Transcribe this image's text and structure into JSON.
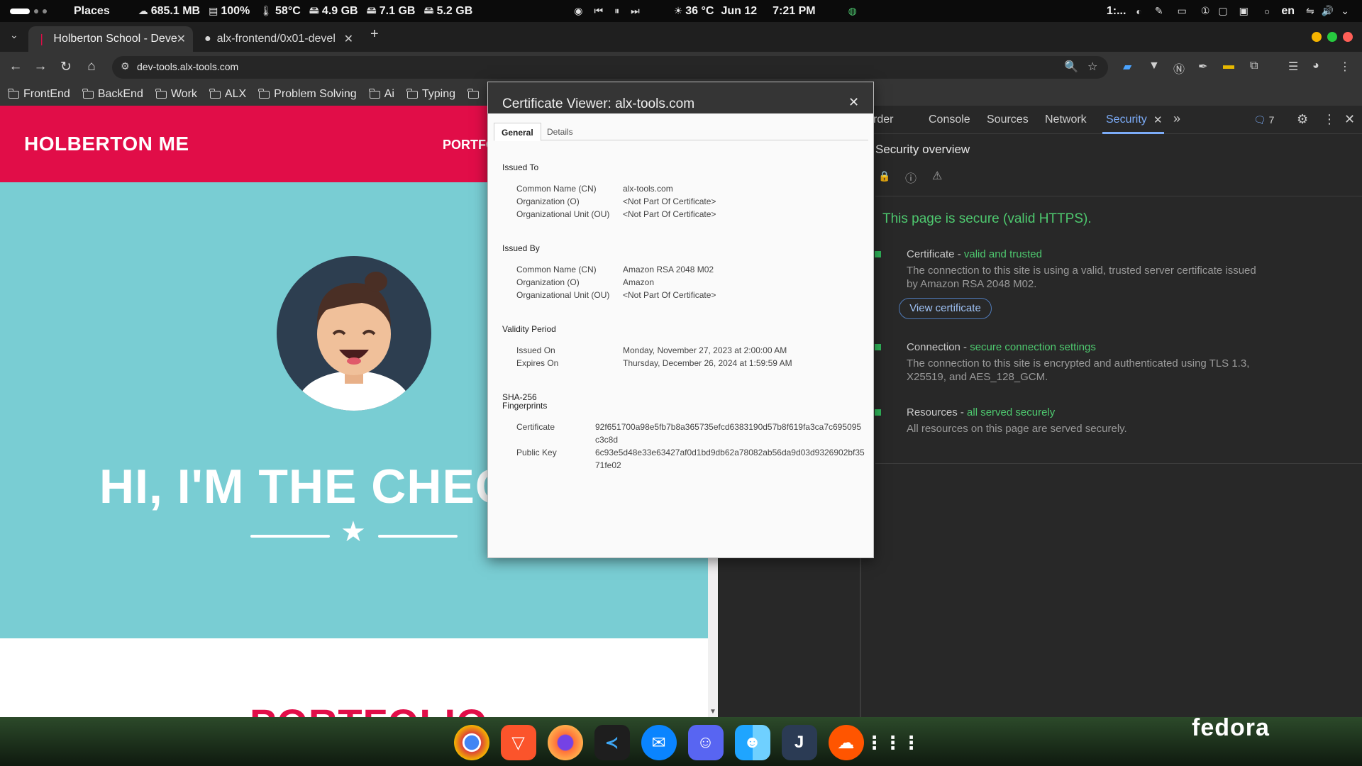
{
  "system_bar": {
    "places": "Places",
    "memory": "685.1 MB",
    "battery": "100%",
    "temp": "58°C",
    "disk1": "4.9 GB",
    "disk2": "7.1 GB",
    "disk3": "5.2 GB",
    "weather": "36 °C",
    "date": "Jun 12",
    "time": "7:21 PM",
    "tray_text": "1:...",
    "language": "en"
  },
  "browser": {
    "tabs": [
      {
        "title": "Holberton School - Deve"
      },
      {
        "title": "alx-frontend/0x01-devel"
      }
    ],
    "new_tab": "+",
    "url": "dev-tools.alx-tools.com",
    "bookmarks": [
      "FrontEnd",
      "BackEnd",
      "Work",
      "ALX",
      "Problem Solving",
      "Ai",
      "Typing"
    ]
  },
  "page": {
    "brand": "HOLBERTON ME",
    "nav_link": "PORTFO",
    "hero_title": "HI, I'M THE CHEC",
    "portfolio_title": "PORTFOLIO"
  },
  "devtools": {
    "tabs": [
      "rder",
      "Console",
      "Sources",
      "Network",
      "Security"
    ],
    "issues_count": "7",
    "overview_title": "Security overview",
    "secure_message": "This page is secure (valid HTTPS).",
    "certificate": {
      "label": "Certificate - ",
      "status": "valid and trusted",
      "description": "The connection to this site is using a valid, trusted server certificate issued by Amazon RSA 2048 M02.",
      "button": "View certificate"
    },
    "connection": {
      "label": "Connection - ",
      "status": "secure connection settings",
      "description": "The connection to this site is encrypted and authenticated using TLS 1.3, X25519, and AES_128_GCM."
    },
    "resources": {
      "label": "Resources - ",
      "status": "all served securely",
      "description": "All resources on this page are served securely."
    }
  },
  "cert_dialog": {
    "title": "Certificate Viewer: alx-tools.com",
    "tabs": [
      "General",
      "Details"
    ],
    "issued_to": {
      "heading": "Issued To",
      "rows": [
        {
          "label": "Common Name (CN)",
          "value": "alx-tools.com"
        },
        {
          "label": "Organization (O)",
          "value": "<Not Part Of Certificate>"
        },
        {
          "label": "Organizational Unit (OU)",
          "value": "<Not Part Of Certificate>"
        }
      ]
    },
    "issued_by": {
      "heading": "Issued By",
      "rows": [
        {
          "label": "Common Name (CN)",
          "value": "Amazon RSA 2048 M02"
        },
        {
          "label": "Organization (O)",
          "value": "Amazon"
        },
        {
          "label": "Organizational Unit (OU)",
          "value": "<Not Part Of Certificate>"
        }
      ]
    },
    "validity": {
      "heading": "Validity Period",
      "rows": [
        {
          "label": "Issued On",
          "value": "Monday, November 27, 2023 at 2:00:00 AM"
        },
        {
          "label": "Expires On",
          "value": "Thursday, December 26, 2024 at 1:59:59 AM"
        }
      ]
    },
    "fingerprints": {
      "heading_line1": "SHA-256",
      "heading_line2": "Fingerprints",
      "rows": [
        {
          "label": "Certificate",
          "value": "92f651700a98e5fb7b8a365735efcd6383190d57b8f619fa3ca7c695095c3c8d"
        },
        {
          "label": "Public Key",
          "value": "6c93e5d48e33e63427af0d1bd9db62a78082ab56da9d03d9326902bf3571fe02"
        }
      ]
    }
  },
  "desktop": {
    "watermark": "fedora",
    "dock_apps": [
      "chrome-icon",
      "brave-icon",
      "firefox-icon",
      "vscode-icon",
      "thunderbird-icon",
      "discord-icon",
      "finder-icon",
      "joplin-icon",
      "soundcloud-icon",
      "app-grid-icon"
    ]
  },
  "colors": {
    "brand_red": "#e10d48",
    "hero_teal": "#79cdd3",
    "secure_green": "#4ec96f",
    "devtools_accent": "#7cacf8"
  }
}
